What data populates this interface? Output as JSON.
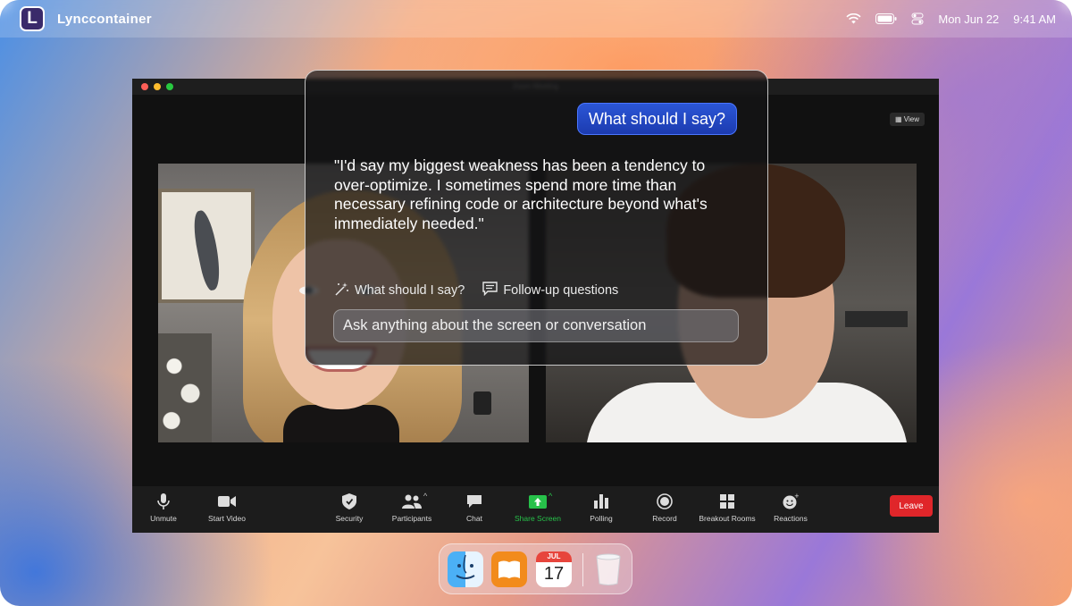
{
  "menubar": {
    "app_logo_letter": "L",
    "app_name": "Lynccontainer",
    "date": "Mon Jun 22",
    "time": "9:41 AM"
  },
  "zoom": {
    "window_title": "Zoom Meeting",
    "view_label": "View",
    "toolbar": [
      {
        "id": "unmute",
        "label": "Unmute",
        "icon": "microphone-icon"
      },
      {
        "id": "start-video",
        "label": "Start Video",
        "icon": "video-camera-icon"
      },
      {
        "id": "security",
        "label": "Security",
        "icon": "shield-icon"
      },
      {
        "id": "participants",
        "label": "Participants",
        "icon": "people-icon"
      },
      {
        "id": "chat",
        "label": "Chat",
        "icon": "chat-bubble-icon"
      },
      {
        "id": "share-screen",
        "label": "Share Screen",
        "icon": "share-arrow-icon"
      },
      {
        "id": "polling",
        "label": "Polling",
        "icon": "bar-chart-icon"
      },
      {
        "id": "record",
        "label": "Record",
        "icon": "record-icon"
      },
      {
        "id": "breakout-rooms",
        "label": "Breakout Rooms",
        "icon": "grid-icon"
      },
      {
        "id": "reactions",
        "label": "Reactions",
        "icon": "smiley-icon"
      }
    ],
    "leave_label": "Leave",
    "share_color": "#27c14a",
    "leave_color": "#e0262a"
  },
  "assistant": {
    "user_question": "What should I say?",
    "answer": "\"I'd say my biggest weakness has been a tendency to over-optimize. I sometimes spend more time than necessary refining code or architecture beyond what's immediately needed.\"",
    "actions": [
      {
        "label": "What should I say?",
        "icon": "magic-wand-icon"
      },
      {
        "label": "Follow-up questions",
        "icon": "chat-list-icon"
      }
    ],
    "input_placeholder": "Ask anything about the screen or conversation",
    "accent_color": "#2b56d6"
  },
  "dock": {
    "apps": [
      {
        "name": "Finder",
        "icon": "finder-icon"
      },
      {
        "name": "Books",
        "icon": "books-icon"
      },
      {
        "name": "Calendar",
        "icon": "calendar-icon"
      },
      {
        "name": "Trash",
        "icon": "trash-icon"
      }
    ],
    "calendar_month": "JUL",
    "calendar_day": "17"
  }
}
